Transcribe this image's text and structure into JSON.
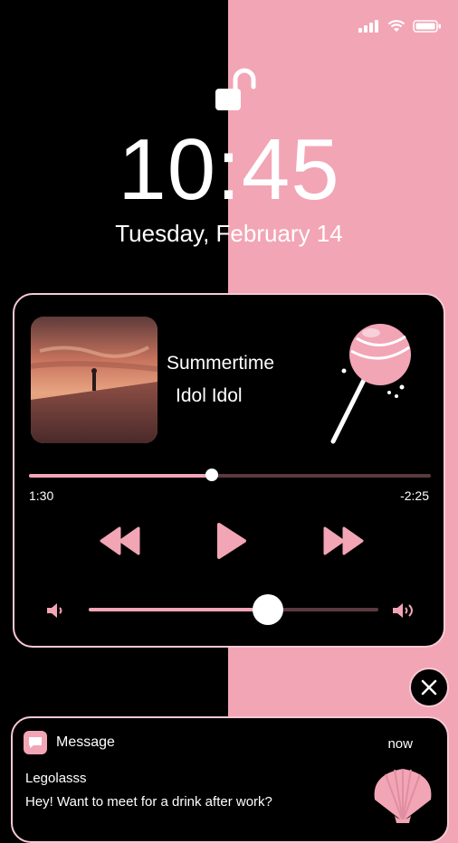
{
  "status_bar": {
    "signal_icon": "signal-bars-icon",
    "wifi_icon": "wifi-icon",
    "battery_icon": "battery-icon"
  },
  "lock_screen": {
    "lock_icon": "unlocked-padlock-icon",
    "time": "10:45",
    "date": "Tuesday, February 14"
  },
  "player": {
    "album_art": "sunset-photo",
    "song_title": "Summertime",
    "artist": "Idol Idol",
    "decoration_icon": "lollipop-icon",
    "progress": {
      "elapsed": "1:30",
      "remaining": "-2:25",
      "fraction": 0.455
    },
    "controls": {
      "rewind_icon": "rewind-icon",
      "play_icon": "play-icon",
      "forward_icon": "fast-forward-icon"
    },
    "volume": {
      "level": 0.62,
      "low_icon": "volume-low-icon",
      "high_icon": "volume-high-icon"
    }
  },
  "close_button": {
    "icon": "close-icon"
  },
  "notification": {
    "app_icon": "message-icon",
    "app_name": "Message",
    "time": "now",
    "sender": "Legolasss",
    "body": "Hey! Want to meet for a drink after work?",
    "decoration_icon": "seashell-icon"
  },
  "colors": {
    "pink": "#f2a5b5",
    "light_pink": "#f7c9d3",
    "black": "#000000",
    "white": "#ffffff"
  }
}
